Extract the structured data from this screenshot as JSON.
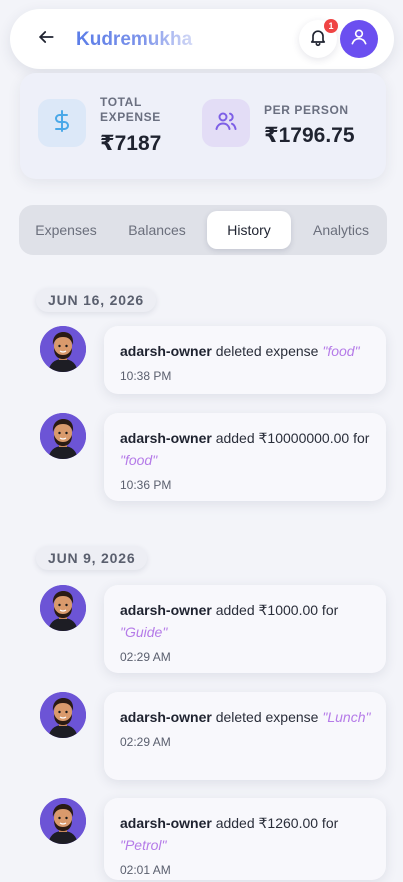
{
  "header": {
    "title": "Kudremukha",
    "notification_count": "1"
  },
  "summary": {
    "total_label": "TOTAL EXPENSE",
    "total_value": "₹7187",
    "per_person_label": "PER PERSON",
    "per_person_value": "₹1796.75"
  },
  "tabs": [
    {
      "label": "Expenses"
    },
    {
      "label": "Balances"
    },
    {
      "label": "History"
    },
    {
      "label": "Analytics"
    }
  ],
  "history": {
    "groups": [
      {
        "date": "JUN 16, 2026",
        "entries": [
          {
            "user": "adarsh-owner",
            "action": "deleted expense",
            "item": "\"food\"",
            "time": "10:38 PM"
          },
          {
            "user": "adarsh-owner",
            "action": "added ₹10000000.00 for",
            "item": "\"food\"",
            "time": "10:36 PM"
          }
        ]
      },
      {
        "date": "JUN 9, 2026",
        "entries": [
          {
            "user": "adarsh-owner",
            "action": "added ₹1000.00 for",
            "item": "\"Guide\"",
            "time": "02:29 AM"
          },
          {
            "user": "adarsh-owner",
            "action": "deleted expense",
            "item": "\"Lunch\"",
            "time": "02:29 AM"
          },
          {
            "user": "adarsh-owner",
            "action": "added ₹1260.00 for",
            "item": "\"Petrol\"",
            "time": "02:01 AM"
          }
        ]
      }
    ]
  },
  "icons": {
    "back": "arrow-left-icon",
    "bell": "bell-icon",
    "profile": "user-icon",
    "total": "dollar-icon",
    "per_person": "users-icon"
  },
  "colors": {
    "accent": "#6b4ff0",
    "title_gradient_start": "#5b7de8",
    "item_highlight": "#b57be8",
    "badge": "#ef4444"
  }
}
